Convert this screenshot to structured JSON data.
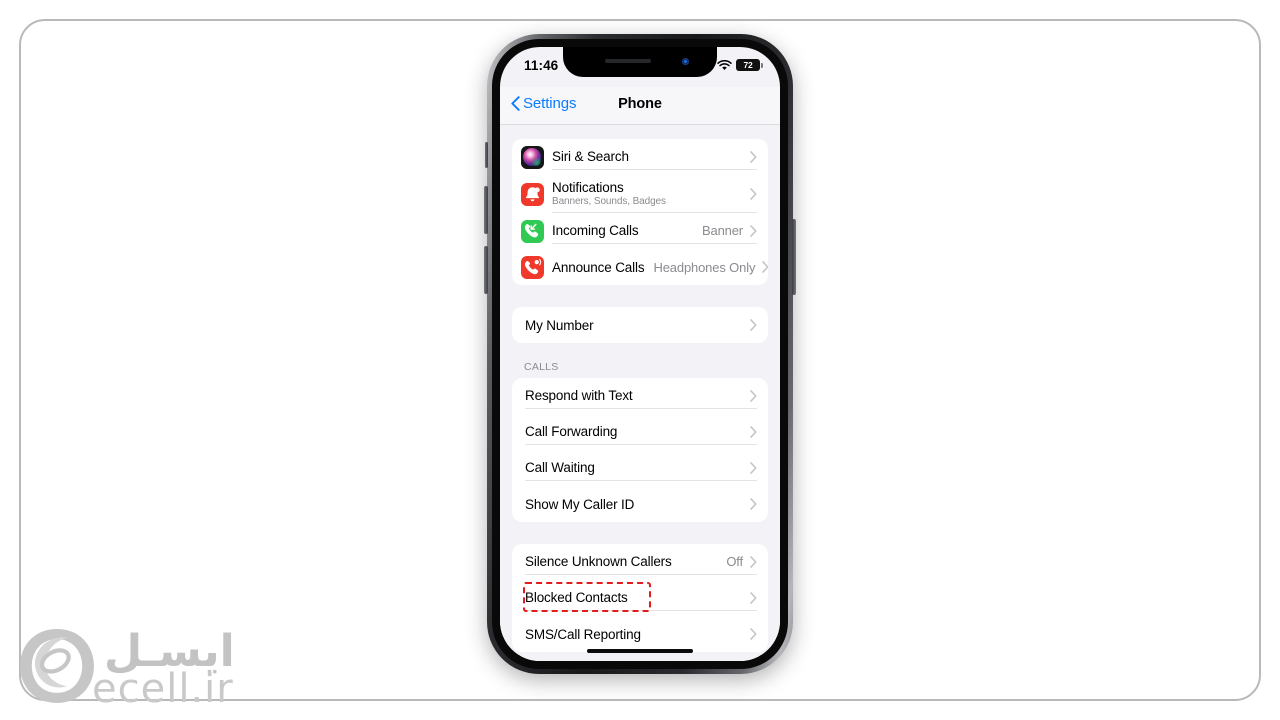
{
  "device": {
    "status_bar": {
      "time": "11:46",
      "location_icon": "location-arrow-icon",
      "cellular_icon": "cellular-signal-icon",
      "wifi_icon": "wifi-icon",
      "battery_percent": "72"
    },
    "nav": {
      "back_label": "Settings",
      "title": "Phone"
    }
  },
  "sections": [
    {
      "header": "",
      "rows": [
        {
          "icon": "siri-icon",
          "title": "Siri & Search",
          "subtitle": "",
          "value": "",
          "chevron": true
        },
        {
          "icon": "notifications-bell-icon",
          "title": "Notifications",
          "subtitle": "Banners, Sounds, Badges",
          "value": "",
          "chevron": true
        },
        {
          "icon": "incoming-call-icon",
          "title": "Incoming Calls",
          "subtitle": "",
          "value": "Banner",
          "chevron": true
        },
        {
          "icon": "announce-calls-icon",
          "title": "Announce Calls",
          "subtitle": "",
          "value": "Headphones Only",
          "chevron": true
        }
      ]
    },
    {
      "header": "",
      "rows": [
        {
          "icon": "",
          "title": "My Number",
          "subtitle": "",
          "value": "",
          "chevron": true
        }
      ]
    },
    {
      "header": "CALLS",
      "rows": [
        {
          "icon": "",
          "title": "Respond with Text",
          "subtitle": "",
          "value": "",
          "chevron": true
        },
        {
          "icon": "",
          "title": "Call Forwarding",
          "subtitle": "",
          "value": "",
          "chevron": true
        },
        {
          "icon": "",
          "title": "Call Waiting",
          "subtitle": "",
          "value": "",
          "chevron": true
        },
        {
          "icon": "",
          "title": "Show My Caller ID",
          "subtitle": "",
          "value": "",
          "chevron": true
        }
      ]
    },
    {
      "header": "",
      "rows": [
        {
          "icon": "",
          "title": "Silence Unknown Callers",
          "subtitle": "",
          "value": "Off",
          "chevron": true
        },
        {
          "icon": "",
          "title": "Blocked Contacts",
          "subtitle": "",
          "value": "",
          "chevron": true,
          "highlighted": true
        },
        {
          "icon": "",
          "title": "SMS/Call Reporting",
          "subtitle": "",
          "value": "",
          "chevron": true
        }
      ]
    }
  ],
  "watermark": {
    "farsi": "ایسـل",
    "latin": "ecell.ir"
  },
  "colors": {
    "accent_blue": "#0a7cff",
    "highlight_red": "#e21b1b",
    "ios_bg": "#f2f2f7",
    "row_white": "#ffffff",
    "secondary_text": "#8b8b90"
  }
}
